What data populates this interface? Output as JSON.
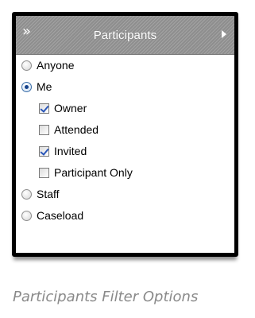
{
  "panel": {
    "title": "Participants",
    "collapse_glyph": "»",
    "icons": [
      "double-chevron-icon",
      "triangle-right-icon"
    ]
  },
  "options": {
    "anyone": {
      "label": "Anyone",
      "checked": false
    },
    "me": {
      "label": "Me",
      "checked": true
    },
    "owner": {
      "label": "Owner",
      "checked": true
    },
    "attended": {
      "label": "Attended",
      "checked": false
    },
    "invited": {
      "label": "Invited",
      "checked": true
    },
    "participant_only": {
      "label": "Participant Only",
      "checked": false
    },
    "staff": {
      "label": "Staff",
      "checked": false
    },
    "caseload": {
      "label": "Caseload",
      "checked": false
    }
  },
  "caption": "Participants Filter Options",
  "colors": {
    "header": "#8e8e8e",
    "radio_dot": "#15428b",
    "check": "#2a56b8",
    "caption": "#8a8a8a"
  }
}
